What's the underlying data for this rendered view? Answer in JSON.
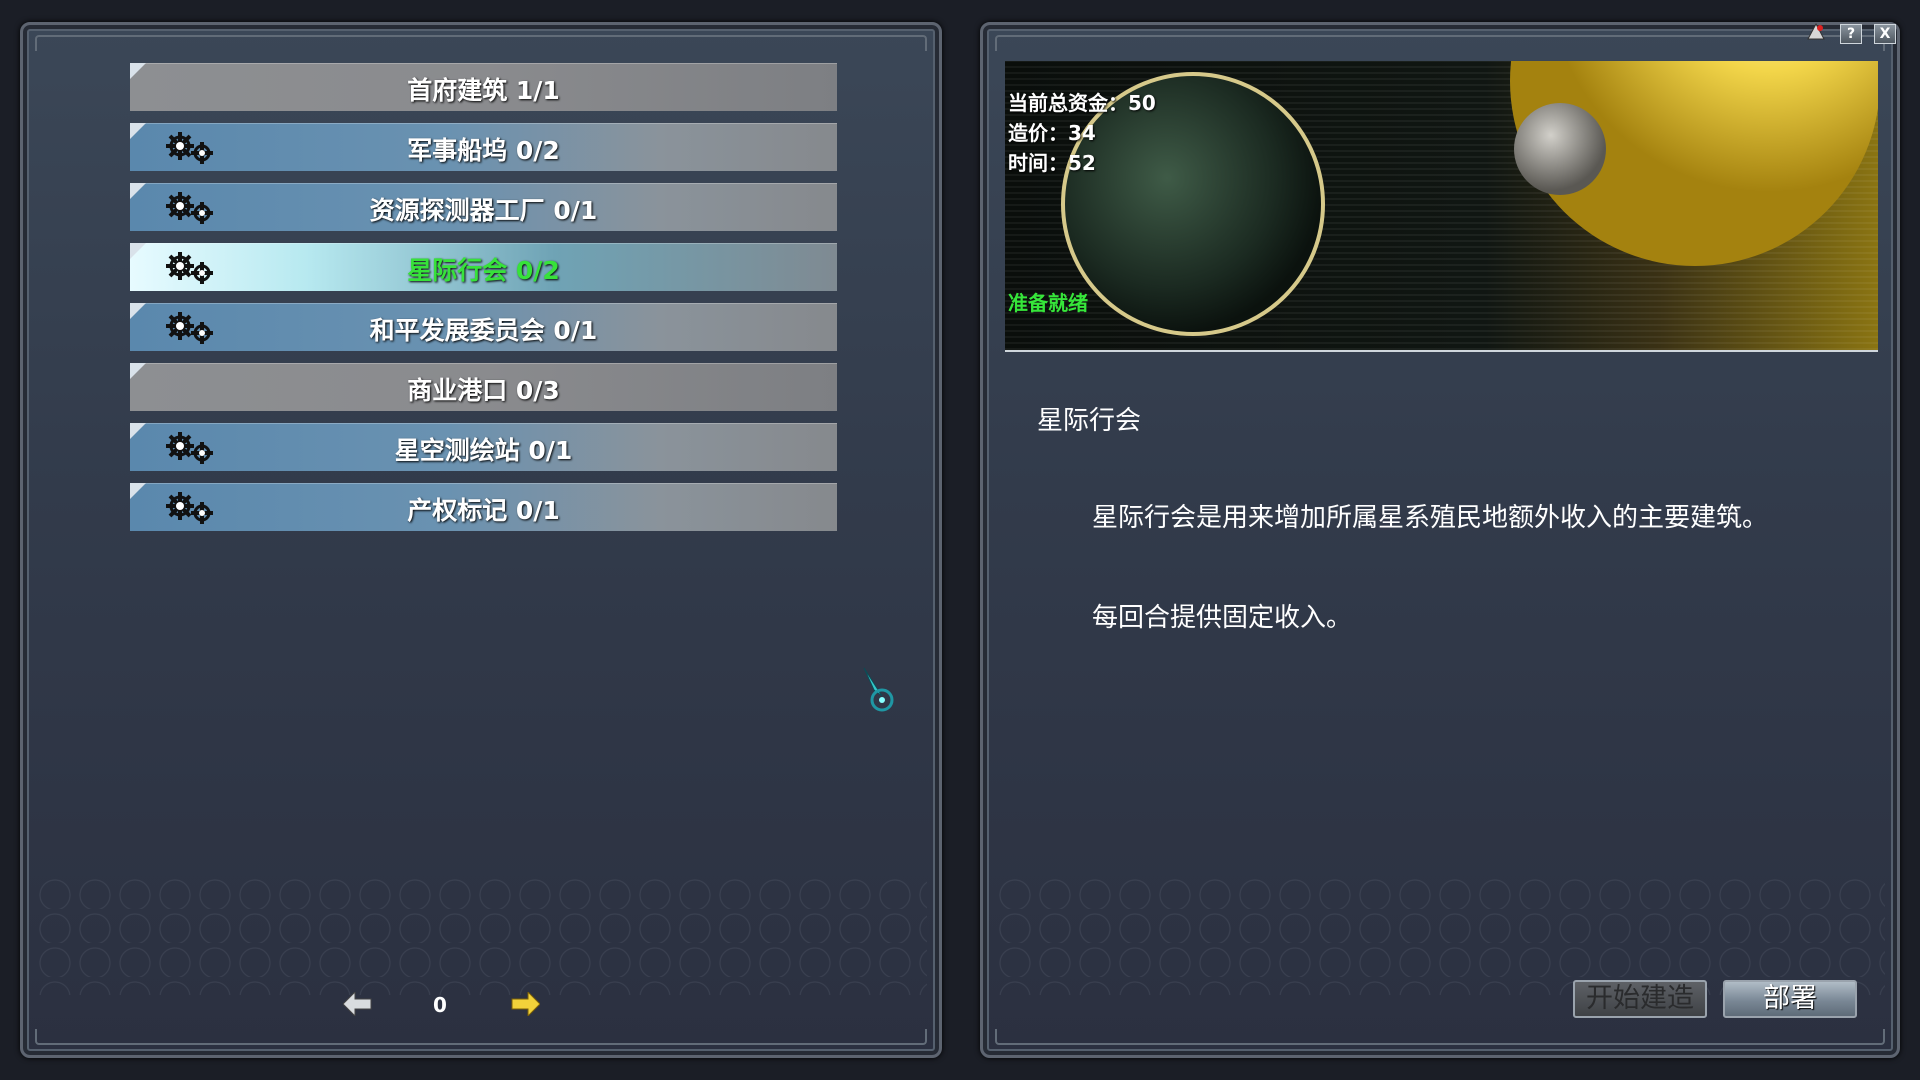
{
  "buildings": [
    {
      "label": "首府建筑 1/1",
      "state": "locked",
      "icon": "none"
    },
    {
      "label": "军事船坞 0/2",
      "state": "available",
      "icon": "gears-icon"
    },
    {
      "label": "资源探测器工厂 0/1",
      "state": "available",
      "icon": "gears-icon"
    },
    {
      "label": "星际行会 0/2",
      "state": "selected",
      "icon": "gears-icon"
    },
    {
      "label": "和平发展委员会 0/1",
      "state": "available",
      "icon": "gears-icon"
    },
    {
      "label": "商业港口 0/3",
      "state": "locked",
      "icon": "none"
    },
    {
      "label": "星空测绘站 0/1",
      "state": "available",
      "icon": "gears-icon"
    },
    {
      "label": "产权标记 0/1",
      "state": "available",
      "icon": "gears-icon"
    }
  ],
  "pager": {
    "page": "0"
  },
  "stats": {
    "funds": "当前总资金：50",
    "cost": "造价：34",
    "time": "时间：52",
    "status": "准备就绪"
  },
  "detail": {
    "title": "星际行会",
    "desc_line_1": "星际行会是用来增加所属星系殖民地额外收入的主要建筑。",
    "desc_line_2": "每回合提供固定收入。"
  },
  "buttons": {
    "start_build": "开始建造",
    "deploy": "部署",
    "help": "?",
    "close": "X"
  },
  "colors": {
    "selected_text": "#37e23a",
    "status_text": "#36e63a",
    "arrow": "#f2d23a"
  }
}
